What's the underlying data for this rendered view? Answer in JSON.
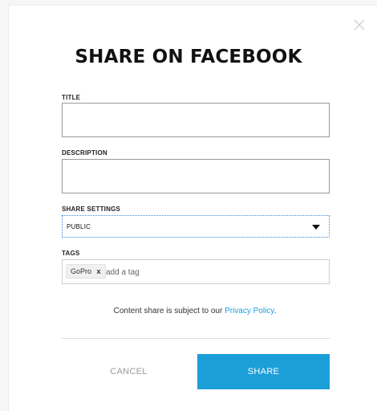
{
  "dialog": {
    "title": "SHARE ON FACEBOOK",
    "close_icon": "close-icon"
  },
  "form": {
    "title_label": "TITLE",
    "title_value": "",
    "description_label": "DESCRIPTION",
    "description_value": "",
    "share_settings_label": "SHARE SETTINGS",
    "share_settings_value": "PUBLIC",
    "share_settings_icon": "caret-down-icon",
    "tags_label": "TAGS",
    "tags": [
      {
        "label": "GoPro",
        "remove": "x"
      }
    ],
    "tag_placeholder": "add a tag"
  },
  "policy": {
    "text": "Content share is subject to our ",
    "link": "Privacy Policy",
    "suffix": "."
  },
  "actions": {
    "cancel_label": "CANCEL",
    "share_label": "SHARE"
  },
  "colors": {
    "accent": "#1c9ed8",
    "link": "#1a9fe0",
    "focus_border": "#3a8ad6"
  }
}
